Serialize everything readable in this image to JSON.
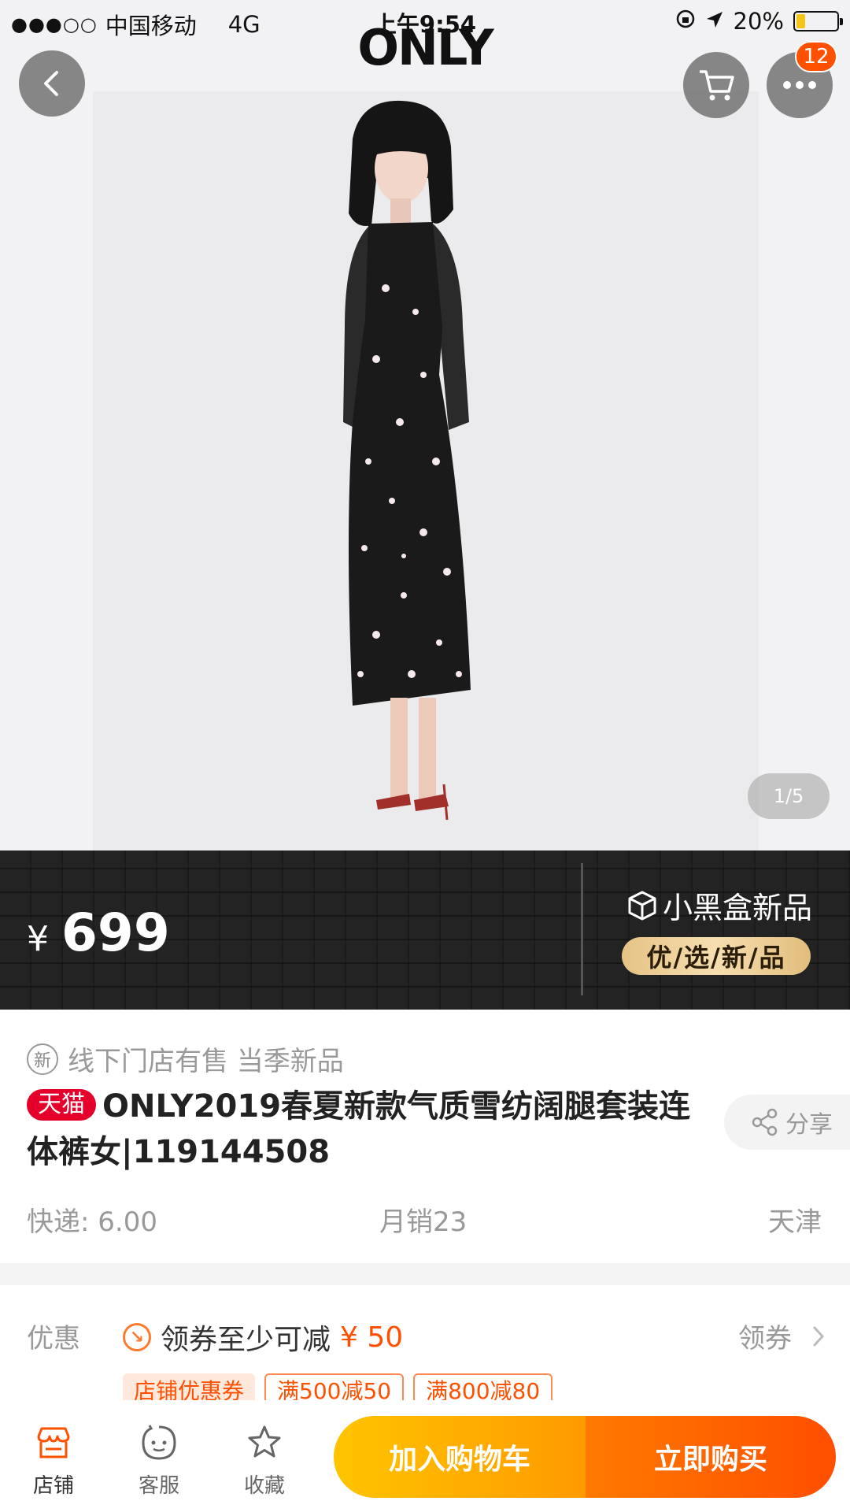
{
  "status_bar": {
    "signal": "●●●○○",
    "carrier": "中国移动",
    "network": "4G",
    "time": "上午9:54",
    "battery": "20%",
    "battery_level": 0.2
  },
  "header": {
    "brand": "ONLY",
    "cart_badge": "12"
  },
  "gallery": {
    "pager": "1/5"
  },
  "price_banner": {
    "currency": "¥",
    "price": "699",
    "box_title": "小黑盒新品",
    "box_tag": "优/选/新/品"
  },
  "product": {
    "new_badge": "新",
    "availability": "线下门店有售 当季新品",
    "platform_tag": "天猫",
    "title": "ONLY2019春夏新款气质雪纺阔腿套装连体裤女|119144508",
    "share": "分享",
    "shipping": "快递: 6.00",
    "monthly_sales": "月销23",
    "location": "天津"
  },
  "coupons": {
    "label": "优惠",
    "text": "领券至少可减",
    "amount": "¥ 50",
    "claim": "领券",
    "tags": [
      "店铺优惠券",
      "满500减50",
      "满800减80"
    ]
  },
  "bottom_bar": {
    "store": "店铺",
    "service": "客服",
    "favorite": "收藏",
    "add_to_cart": "加入购物车",
    "buy_now": "立即购买"
  }
}
